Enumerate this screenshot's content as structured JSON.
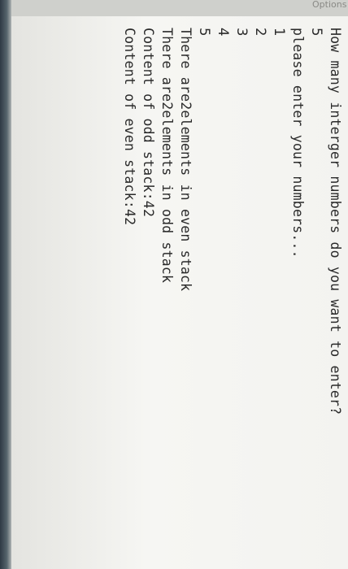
{
  "window": {
    "partial_label": "Options"
  },
  "console": {
    "lines": [
      "How many interger numbers do you want to enter?",
      "5",
      "please enter your numbers...",
      "1",
      "2",
      "3",
      "4",
      "5",
      "There are2elements in even stack",
      "There are2elements in odd stack",
      "Content of odd stack:42",
      "Content of even stack:42"
    ]
  },
  "colors": {
    "background": "#f3f3f0",
    "text": "#2a2a2a",
    "top_bar": "#cfd0cc"
  }
}
